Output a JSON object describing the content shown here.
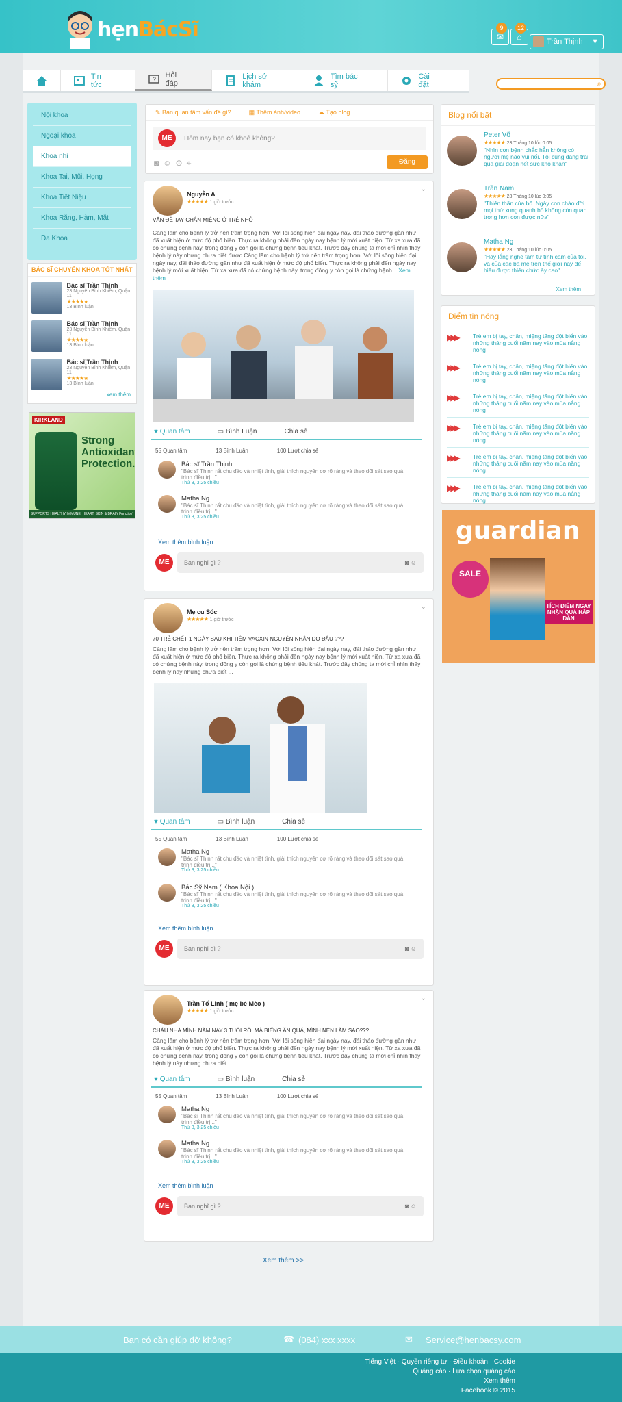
{
  "brand": {
    "part1": "hẹn",
    "part2": "BácSĩ"
  },
  "header": {
    "notif1_count": "9",
    "notif2_count": "12",
    "user_name": "Trần Thịnh"
  },
  "nav": [
    {
      "label": ""
    },
    {
      "label": "Tin tức"
    },
    {
      "label": "Hỏi đáp"
    },
    {
      "label": "Lịch sử khám"
    },
    {
      "label": "Tìm bác sỹ"
    },
    {
      "label": "Cài đặt"
    }
  ],
  "specialties": [
    "Nội khoa",
    "Ngoại khoa",
    "Khoa nhi",
    "Khoa Tai, Mũi, Họng",
    "Khoa Tiết Niệu",
    "Khoa Răng, Hàm, Mặt",
    "Đa Khoa"
  ],
  "top_doctors": {
    "title": "BÁC SĨ CHUYÊN KHOA TỐT NHẤT",
    "more": "xem thêm",
    "items": [
      {
        "name": "Bác sĩ Trần Thịnh",
        "address": "23 Nguyễn Bỉnh Khiêm, Quận 11",
        "stars": "★★★★★",
        "reviews": "13 Bình luận"
      },
      {
        "name": "Bác sĩ Trần Thịnh",
        "address": "23 Nguyễn Bỉnh Khiêm, Quận 11",
        "stars": "★★★★★",
        "reviews": "13 Bình luận"
      },
      {
        "name": "Bác sĩ Trần Thịnh",
        "address": "23 Nguyễn Bỉnh Khiêm, Quận 11",
        "stars": "★★★★★",
        "reviews": "13 Bình luận"
      }
    ]
  },
  "ad_left": {
    "brand": "KIRKLAND",
    "text": "Strong Antioxidant Protection.",
    "footer": "SUPPORTS HEALTHY IMMUNE, HEART, SKIN & BRAIN Function*"
  },
  "composer": {
    "tab1": "Bạn quan tâm vấn đề gì?",
    "tab2": "Thêm ảnh/video",
    "tab3": "Tạo blog",
    "avatar": "ME",
    "placeholder": "Hôm nay bạn có khoẻ không?",
    "post_label": "Đăng"
  },
  "posts": [
    {
      "name": "Nguyễn A",
      "stars": "★★★★★",
      "time": "1 giờ trước",
      "title": "VẤN ĐỀ TAY CHÂN MIỆNG Ở TRẺ NHỎ",
      "body": "Càng lâm cho bệnh lý trở nên trầm trọng hơn. Với lối sống hiện đại ngày nay, đái tháo đường gần như đã xuất hiện ở mức độ phổ biến. Thực ra không phải đến ngày nay bệnh lý mới xuất hiện. Từ xa xưa đã có chứng bệnh này, trong đông y còn gọi là chứng bệnh tiêu khát. Trước đây chúng ta mới chỉ nhìn thấy bệnh lý này nhưng chưa biết được Càng lâm cho bệnh lý trở nên trầm trọng hơn. Với lối sống hiện đại ngày nay, đái tháo đường gần như đã xuất hiện ở mức độ phổ biến. Thực ra không phải đến ngày nay bệnh lý mới xuất hiện. Từ xa xưa đã có chứng bệnh này, trong đông y còn gọi là chứng bệnh...",
      "see_more": "Xem thêm",
      "care": "Quan tâm",
      "comment": "Bình Luận",
      "share": "Chia sẻ",
      "stat_care": "55 Quan tâm",
      "stat_comment": "13 Bình Luận",
      "stat_share": "100 Lượt chia sẻ",
      "comments": [
        {
          "name": "Bác sĩ Trần Thịnh",
          "text": "\"Bác sĩ Thịnh rất chu đáo và nhiệt tình, giải thích nguyên cơ rõ ràng và theo dõi sát sao quá trình điều trị...\"",
          "date": "Thứ 3, 3:25 chiều"
        },
        {
          "name": "Matha Ng",
          "text": "\"Bác sĩ Thịnh rất chu đáo và nhiệt tình, giải thích nguyên cơ rõ ràng và theo dõi sát sao quá trình điều trị...\"",
          "date": "Thứ 3, 3:25 chiều"
        }
      ],
      "more_comments": "Xem thêm bình luận",
      "reply_avatar": "ME",
      "reply_placeholder": "Bạn nghĩ gì ?"
    },
    {
      "name": "Mẹ cu Sóc",
      "stars": "★★★★★",
      "time": "1 giờ trước",
      "title": "70 TRẺ CHẾT 1 NGÀY SAU KHI TIÊM VACXIN NGUYÊN NHÂN DO ĐÂU ???",
      "body": "Càng lâm cho bệnh lý trở nên trầm trọng hơn. Với lối sống hiện đại ngày nay, đái tháo đường gần như đã xuất hiện ở mức độ phổ biến. Thực ra không phải đến ngày nay bệnh lý mới xuất hiện. Từ xa xưa đã có chứng bệnh này, trong đông y còn gọi là chứng bệnh tiêu khát. Trước đây chúng ta mới chỉ nhìn thấy bệnh lý này nhưng chưa biết ...",
      "care": "Quan tâm",
      "comment": "Bình luận",
      "share": "Chia sẻ",
      "stat_care": "55 Quan tâm",
      "stat_comment": "13 Bình Luận",
      "stat_share": "100 Lượt chia sẻ",
      "comments": [
        {
          "name": "Matha Ng",
          "text": "\"Bác sĩ Thịnh rất chu đáo và nhiệt tình, giải thích nguyên cơ rõ ràng và theo dõi sát sao quá trình điều trị...\"",
          "date": "Thứ 3, 3:25 chiều"
        },
        {
          "name": "Bác Sỹ Nam ( Khoa Nội )",
          "text": "\"Bác sĩ Thịnh rất chu đáo và nhiệt tình, giải thích nguyên cơ rõ ràng và theo dõi sát sao quá trình điều trị...\"",
          "date": "Thứ 3, 3:25 chiều"
        }
      ],
      "more_comments": "Xem thêm bình luận",
      "reply_avatar": "ME",
      "reply_placeholder": "Bạn nghĩ gì ?"
    },
    {
      "name": "Trần Tố Linh ( mẹ bé Mèo )",
      "stars": "★★★★★",
      "time": "1 giờ trước",
      "title": "CHÁU NHÀ MÌNH NĂM NAY 3 TUỔI RỒI MÀ BIẾNG ĂN QUÁ, MÌNH NÊN LÀM SAO???",
      "body": "Càng lâm cho bệnh lý trở nên trầm trọng hơn. Với lối sống hiện đại ngày nay, đái tháo đường gần như đã xuất hiện ở mức độ phổ biến. Thực ra không phải đến ngày nay bệnh lý mới xuất hiện. Từ xa xưa đã có chứng bệnh này, trong đông y còn gọi là chứng bệnh tiêu khát. Trước đây chúng ta mới chỉ nhìn thấy bệnh lý này nhưng chưa biết ...",
      "care": "Quan tâm",
      "comment": "Bình luận",
      "share": "Chia sẻ",
      "stat_care": "55 Quan tâm",
      "stat_comment": "13 Bình Luận",
      "stat_share": "100 Lượt chia sẻ",
      "comments": [
        {
          "name": "Matha Ng",
          "text": "\"Bác sĩ Thịnh rất chu đáo và nhiệt tình, giải thích nguyên cơ rõ ràng và theo dõi sát sao quá trình điều trị...\"",
          "date": "Thứ 3, 3:25 chiều"
        },
        {
          "name": "Matha Ng",
          "text": "\"Bác sĩ Thịnh rất chu đáo và nhiệt tình, giải thích nguyên cơ rõ ràng và theo dõi sát sao quá trình điều trị...\"",
          "date": "Thứ 3, 3:25 chiều"
        }
      ],
      "more_comments": "Xem thêm bình luận",
      "reply_avatar": "ME",
      "reply_placeholder": "Bạn nghĩ gì ?"
    }
  ],
  "see_more_posts": "Xem thêm >>",
  "blog": {
    "title": "Blog nổi bật",
    "more": "Xem thêm",
    "items": [
      {
        "name": "Peter Võ",
        "stars": "★★★★★",
        "date": "23 Tháng 10 lúc 0:05",
        "quote": "\"Nhìn con bệnh chắc hẳn không có người mẹ nào vui nổi. Tôi cũng đang trải qua giai đoạn hết sức khó khăn\""
      },
      {
        "name": "Trần Nam",
        "stars": "★★★★★",
        "date": "23 Tháng 10 lúc 0:05",
        "quote": "\"Thiên thần của bố. Ngày con chào đời mọi thứ xung quanh bố không còn quan trọng hơn con được nữa\""
      },
      {
        "name": "Matha Ng",
        "stars": "★★★★★",
        "date": "23 Tháng 10 lúc 0:05",
        "quote": "\"Hãy lắng nghe tâm tư tình cảm của tôi, và của các bà mẹ trên thế giới này để hiểu được thiên chức ấy cao\""
      }
    ]
  },
  "hot": {
    "title": "Điểm tin nóng",
    "items": [
      "Trẻ em bị tay, chân, miệng tăng đột biến vào những tháng cuối năm nay vào mùa nắng nóng",
      "Trẻ em bị tay, chân, miệng tăng đột biến vào những tháng cuối năm nay vào mùa nắng nóng",
      "Trẻ em bị tay, chân, miệng tăng đột biến vào những tháng cuối năm nay vào mùa nắng nóng",
      "Trẻ em bị tay, chân, miệng tăng đột biến vào những tháng cuối năm nay vào mùa nắng nóng",
      "Trẻ em bị tay, chân, miệng tăng đột biến vào những tháng cuối năm nay vào mùa nắng nóng",
      "Trẻ em bị tay, chân, miệng tăng đột biến vào những tháng cuối năm nay vào mùa nắng nóng"
    ]
  },
  "ad_right": {
    "brand": "guardian",
    "sale": "SALE",
    "promo": "TÍCH ĐIỂM NGAY NHẬN QUÀ HẤP DẪN"
  },
  "help": {
    "question": "Bạn có cần giúp đỡ không?",
    "phone": "(084) xxx xxxx",
    "email": "Service@henbacsy.com"
  },
  "footer": {
    "line1": "Tiếng Việt · Quyền riêng tư · Điều khoản · Cookie",
    "line2": "Quảng cáo · Lựa chọn quảng cáo",
    "line3": "Xem thêm",
    "line4": "Facebook © 2015"
  },
  "colors": {
    "accent": "#2aa9b7",
    "orange": "#f39a22",
    "teal_bar": "#36c2c8"
  }
}
